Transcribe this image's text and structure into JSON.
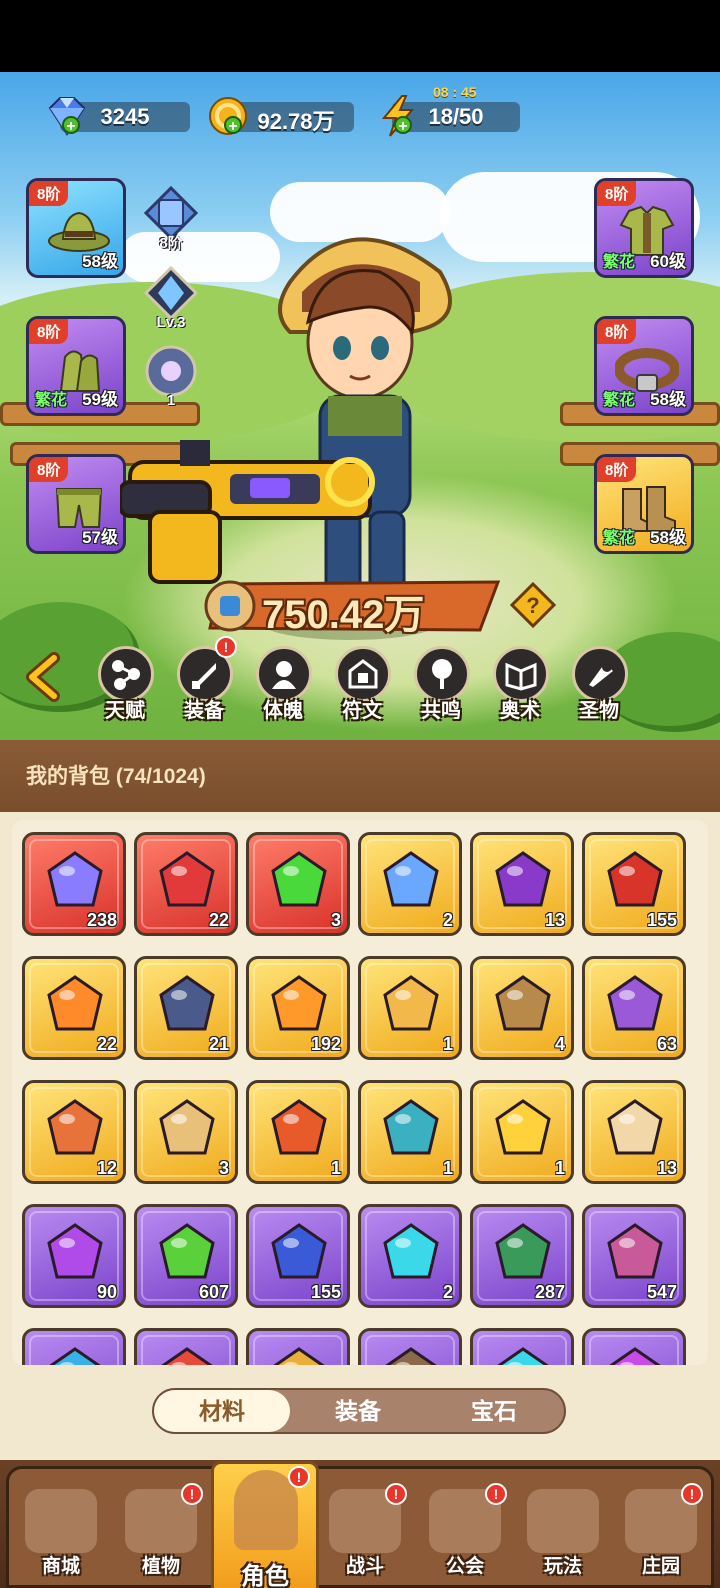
{
  "resources": {
    "gems": "3245",
    "coins": "92.78万",
    "energy": "18/50",
    "energy_timer": "08 : 45"
  },
  "equipment": {
    "left": [
      {
        "tier": "8阶",
        "level": "58级",
        "tag": "",
        "rarity": "blue",
        "icon": "hat-icon"
      },
      {
        "tier": "8阶",
        "level": "59级",
        "tag": "繁花",
        "rarity": "purple",
        "icon": "gloves-icon"
      },
      {
        "tier": "8阶",
        "level": "57级",
        "tag": "",
        "rarity": "purple",
        "icon": "pants-icon"
      }
    ],
    "right": [
      {
        "tier": "8阶",
        "level": "60级",
        "tag": "繁花",
        "rarity": "purple",
        "icon": "shirt-icon"
      },
      {
        "tier": "8阶",
        "level": "58级",
        "tag": "繁花",
        "rarity": "purple",
        "icon": "belt-icon"
      },
      {
        "tier": "8阶",
        "level": "58级",
        "tag": "繁花",
        "rarity": "gold",
        "icon": "boots-icon"
      }
    ],
    "mini": [
      {
        "label": "8阶",
        "icon": "pet-card-icon"
      },
      {
        "label": "Lv.3",
        "icon": "crystal-icon"
      },
      {
        "label": "1",
        "icon": "orb-icon"
      }
    ]
  },
  "power": "750.42万",
  "features": [
    {
      "label": "天赋",
      "icon": "talent-icon",
      "badge": ""
    },
    {
      "label": "装备",
      "icon": "equipment-icon",
      "badge": "!"
    },
    {
      "label": "体魄",
      "icon": "physique-icon",
      "badge": ""
    },
    {
      "label": "符文",
      "icon": "rune-icon",
      "badge": ""
    },
    {
      "label": "共鸣",
      "icon": "resonance-icon",
      "badge": ""
    },
    {
      "label": "奥术",
      "icon": "arcane-icon",
      "badge": ""
    },
    {
      "label": "圣物",
      "icon": "relic-icon",
      "badge": ""
    }
  ],
  "bag": {
    "title": "我的背包 (74/1024)",
    "rows": [
      [
        {
          "qty": "238",
          "rarity": "red",
          "icon": "star-crystal-icon",
          "color": "#8a7cff"
        },
        {
          "qty": "22",
          "rarity": "red",
          "icon": "red-potion-icon",
          "color": "#e23a3a"
        },
        {
          "qty": "3",
          "rarity": "red",
          "icon": "green-vial-icon",
          "color": "#4ad93a"
        },
        {
          "qty": "2",
          "rarity": "gold",
          "icon": "water-drop-icon",
          "color": "#6aa8ff"
        },
        {
          "qty": "13",
          "rarity": "gold",
          "icon": "skull-scroll-icon",
          "color": "#8a3ac9"
        },
        {
          "qty": "155",
          "rarity": "gold",
          "icon": "ladybug-icon",
          "color": "#d8342a"
        }
      ],
      [
        {
          "qty": "22",
          "rarity": "gold",
          "icon": "fire-prism-icon",
          "color": "#ff8a2a"
        },
        {
          "qty": "21",
          "rarity": "gold",
          "icon": "rune-stone-icon",
          "color": "#4a5a8a"
        },
        {
          "qty": "192",
          "rarity": "gold",
          "icon": "orange-potion-icon",
          "color": "#ff9a2a"
        },
        {
          "qty": "1",
          "rarity": "gold",
          "icon": "sand-pile-icon",
          "color": "#f2b84a"
        },
        {
          "qty": "4",
          "rarity": "gold",
          "icon": "flower-pot-icon",
          "color": "#b88a4a"
        },
        {
          "qty": "63",
          "rarity": "gold",
          "icon": "spell-book-icon",
          "color": "#9a5ad8"
        }
      ],
      [
        {
          "qty": "12",
          "rarity": "gold",
          "icon": "fertilizer-can-icon",
          "color": "#e8733a"
        },
        {
          "qty": "3",
          "rarity": "gold",
          "icon": "chick-puzzle-icon",
          "color": "#e8c07a"
        },
        {
          "qty": "1",
          "rarity": "gold",
          "icon": "amber-gem-icon",
          "color": "#e85a2a"
        },
        {
          "qty": "1",
          "rarity": "gold",
          "icon": "thread-spool-icon",
          "color": "#3ab0c0"
        },
        {
          "qty": "1",
          "rarity": "gold",
          "icon": "golden-lily-icon",
          "color": "#ffd13a"
        },
        {
          "qty": "13",
          "rarity": "gold",
          "icon": "knot-charm-icon",
          "color": "#f2d8a8"
        }
      ],
      [
        {
          "qty": "90",
          "rarity": "purple",
          "icon": "purple-flask-icon",
          "color": "#b04ae8"
        },
        {
          "qty": "607",
          "rarity": "purple",
          "icon": "sprout-icon",
          "color": "#5ad03a"
        },
        {
          "qty": "155",
          "rarity": "purple",
          "icon": "arrow-badge-icon",
          "color": "#3a5ad8"
        },
        {
          "qty": "2",
          "rarity": "purple",
          "icon": "cyan-leaf-icon",
          "color": "#3ad8e8"
        },
        {
          "qty": "287",
          "rarity": "purple",
          "icon": "green-scroll-icon",
          "color": "#3a9a5a"
        },
        {
          "qty": "547",
          "rarity": "purple",
          "icon": "pink-scroll-icon",
          "color": "#c85a9a"
        }
      ],
      [
        {
          "qty": "",
          "rarity": "purple",
          "icon": "item-icon",
          "color": "#3ab0e8"
        },
        {
          "qty": "",
          "rarity": "purple",
          "icon": "item-icon",
          "color": "#e84a3a"
        },
        {
          "qty": "",
          "rarity": "purple",
          "icon": "item-icon",
          "color": "#e8b03a"
        },
        {
          "qty": "",
          "rarity": "purple",
          "icon": "item-icon",
          "color": "#8a6a4a"
        },
        {
          "qty": "",
          "rarity": "purple",
          "icon": "item-icon",
          "color": "#3ad8e8"
        },
        {
          "qty": "",
          "rarity": "purple",
          "icon": "item-icon",
          "color": "#c84ae8"
        }
      ]
    ]
  },
  "tabs": [
    {
      "label": "材料",
      "active": true
    },
    {
      "label": "装备",
      "active": false
    },
    {
      "label": "宝石",
      "active": false
    }
  ],
  "nav": [
    {
      "label": "商城",
      "badge": "",
      "active": false
    },
    {
      "label": "植物",
      "badge": "!",
      "active": false
    },
    {
      "label": "角色",
      "badge": "!",
      "active": true
    },
    {
      "label": "战斗",
      "badge": "!",
      "active": false
    },
    {
      "label": "公会",
      "badge": "!",
      "active": false
    },
    {
      "label": "玩法",
      "badge": "",
      "active": false
    },
    {
      "label": "庄园",
      "badge": "!",
      "active": false
    }
  ]
}
